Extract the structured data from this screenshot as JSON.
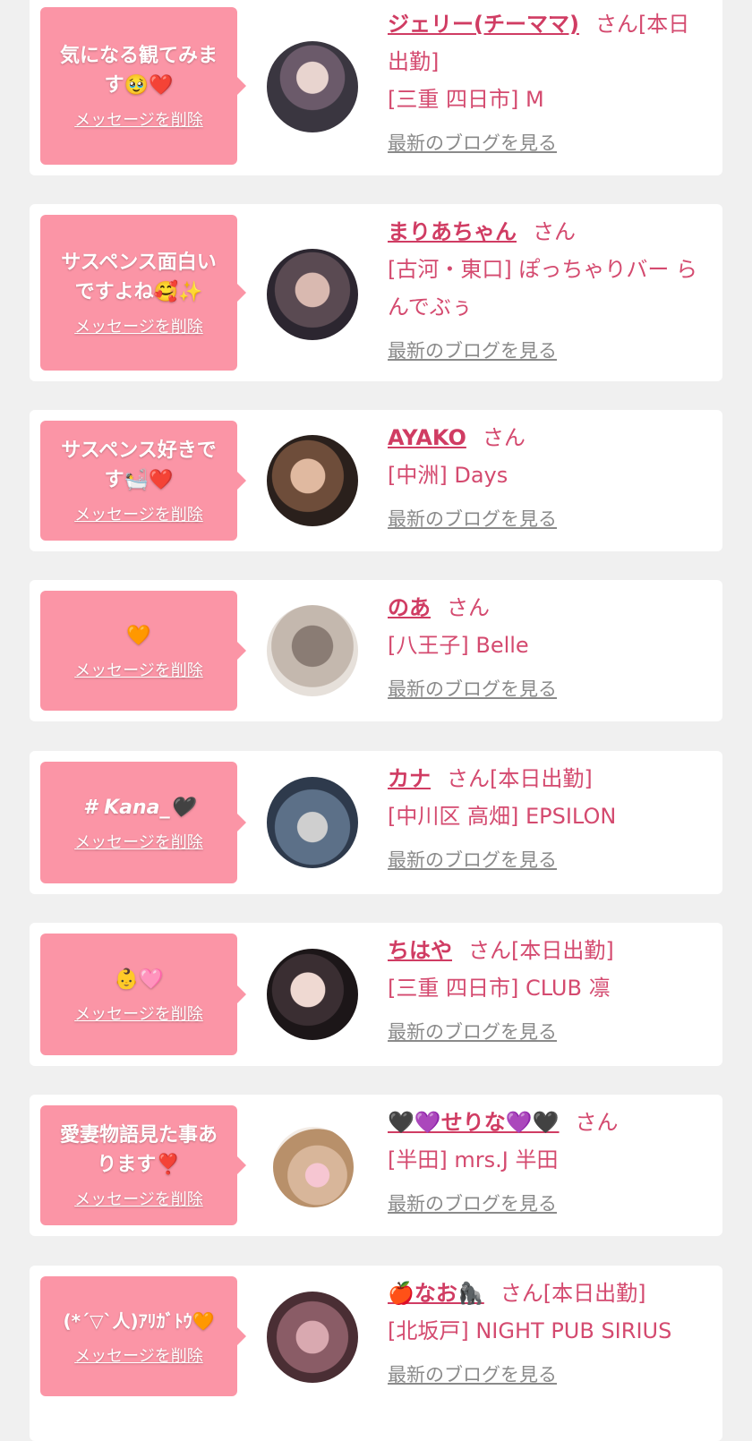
{
  "delete_label": "メッセージを削除",
  "blog_label": "最新のブログを見る",
  "san_label": "さん",
  "colors": {
    "bubble": "#fb95a6",
    "name": "#d03c63",
    "shop": "#d44a6f",
    "blog": "#8a8a8a",
    "bg": "#f0f0f0"
  },
  "items": [
    {
      "message": "気になる観てみます🥹❤️",
      "name": "ジェリー(チーママ)",
      "status": "[本日出勤]",
      "shop": "[三重 四日市] M",
      "avatar": "avatar-woman-crown"
    },
    {
      "message": "サスペンス面白いですよね🥰✨",
      "name": "まりあちゃん",
      "status": "",
      "shop": "[古河・東口] ぽっちゃりバー らんでぶぅ",
      "avatar": "avatar-woman-happy-glasses"
    },
    {
      "message": "サスペンス好きです🛀❤️",
      "name": "AYAKO",
      "status": "",
      "shop": "[中洲] Days",
      "avatar": "avatar-woman-pouting"
    },
    {
      "message": "🧡",
      "name": "のあ",
      "status": "",
      "shop": "[八王子] Belle",
      "avatar": "avatar-woman-back-hair"
    },
    {
      "message": "# Kana_🖤",
      "name": "カナ",
      "status": "[本日出勤]",
      "shop": "[中川区 高畑] EPSILON",
      "avatar": "avatar-woman-cow-ears"
    },
    {
      "message": "👶🩷",
      "name": "ちはや",
      "status": "[本日出勤]",
      "shop": "[三重 四日市] CLUB 凛",
      "avatar": "avatar-woman-selfie"
    },
    {
      "message": "愛妻物語見た事あります❣️",
      "name": "🖤💜せりな💜🖤",
      "status": "",
      "shop": "[半田] mrs.J 半田",
      "avatar": "avatar-woman-blonde"
    },
    {
      "message": "(*´▽`人)ｱﾘｶﾞﾄｳ🧡",
      "name": "🍎なお🦍",
      "status": "[本日出勤]",
      "shop": "[北坂戸] NIGHT PUB SIRIUS",
      "avatar": "avatar-woman-pink-hair"
    }
  ]
}
